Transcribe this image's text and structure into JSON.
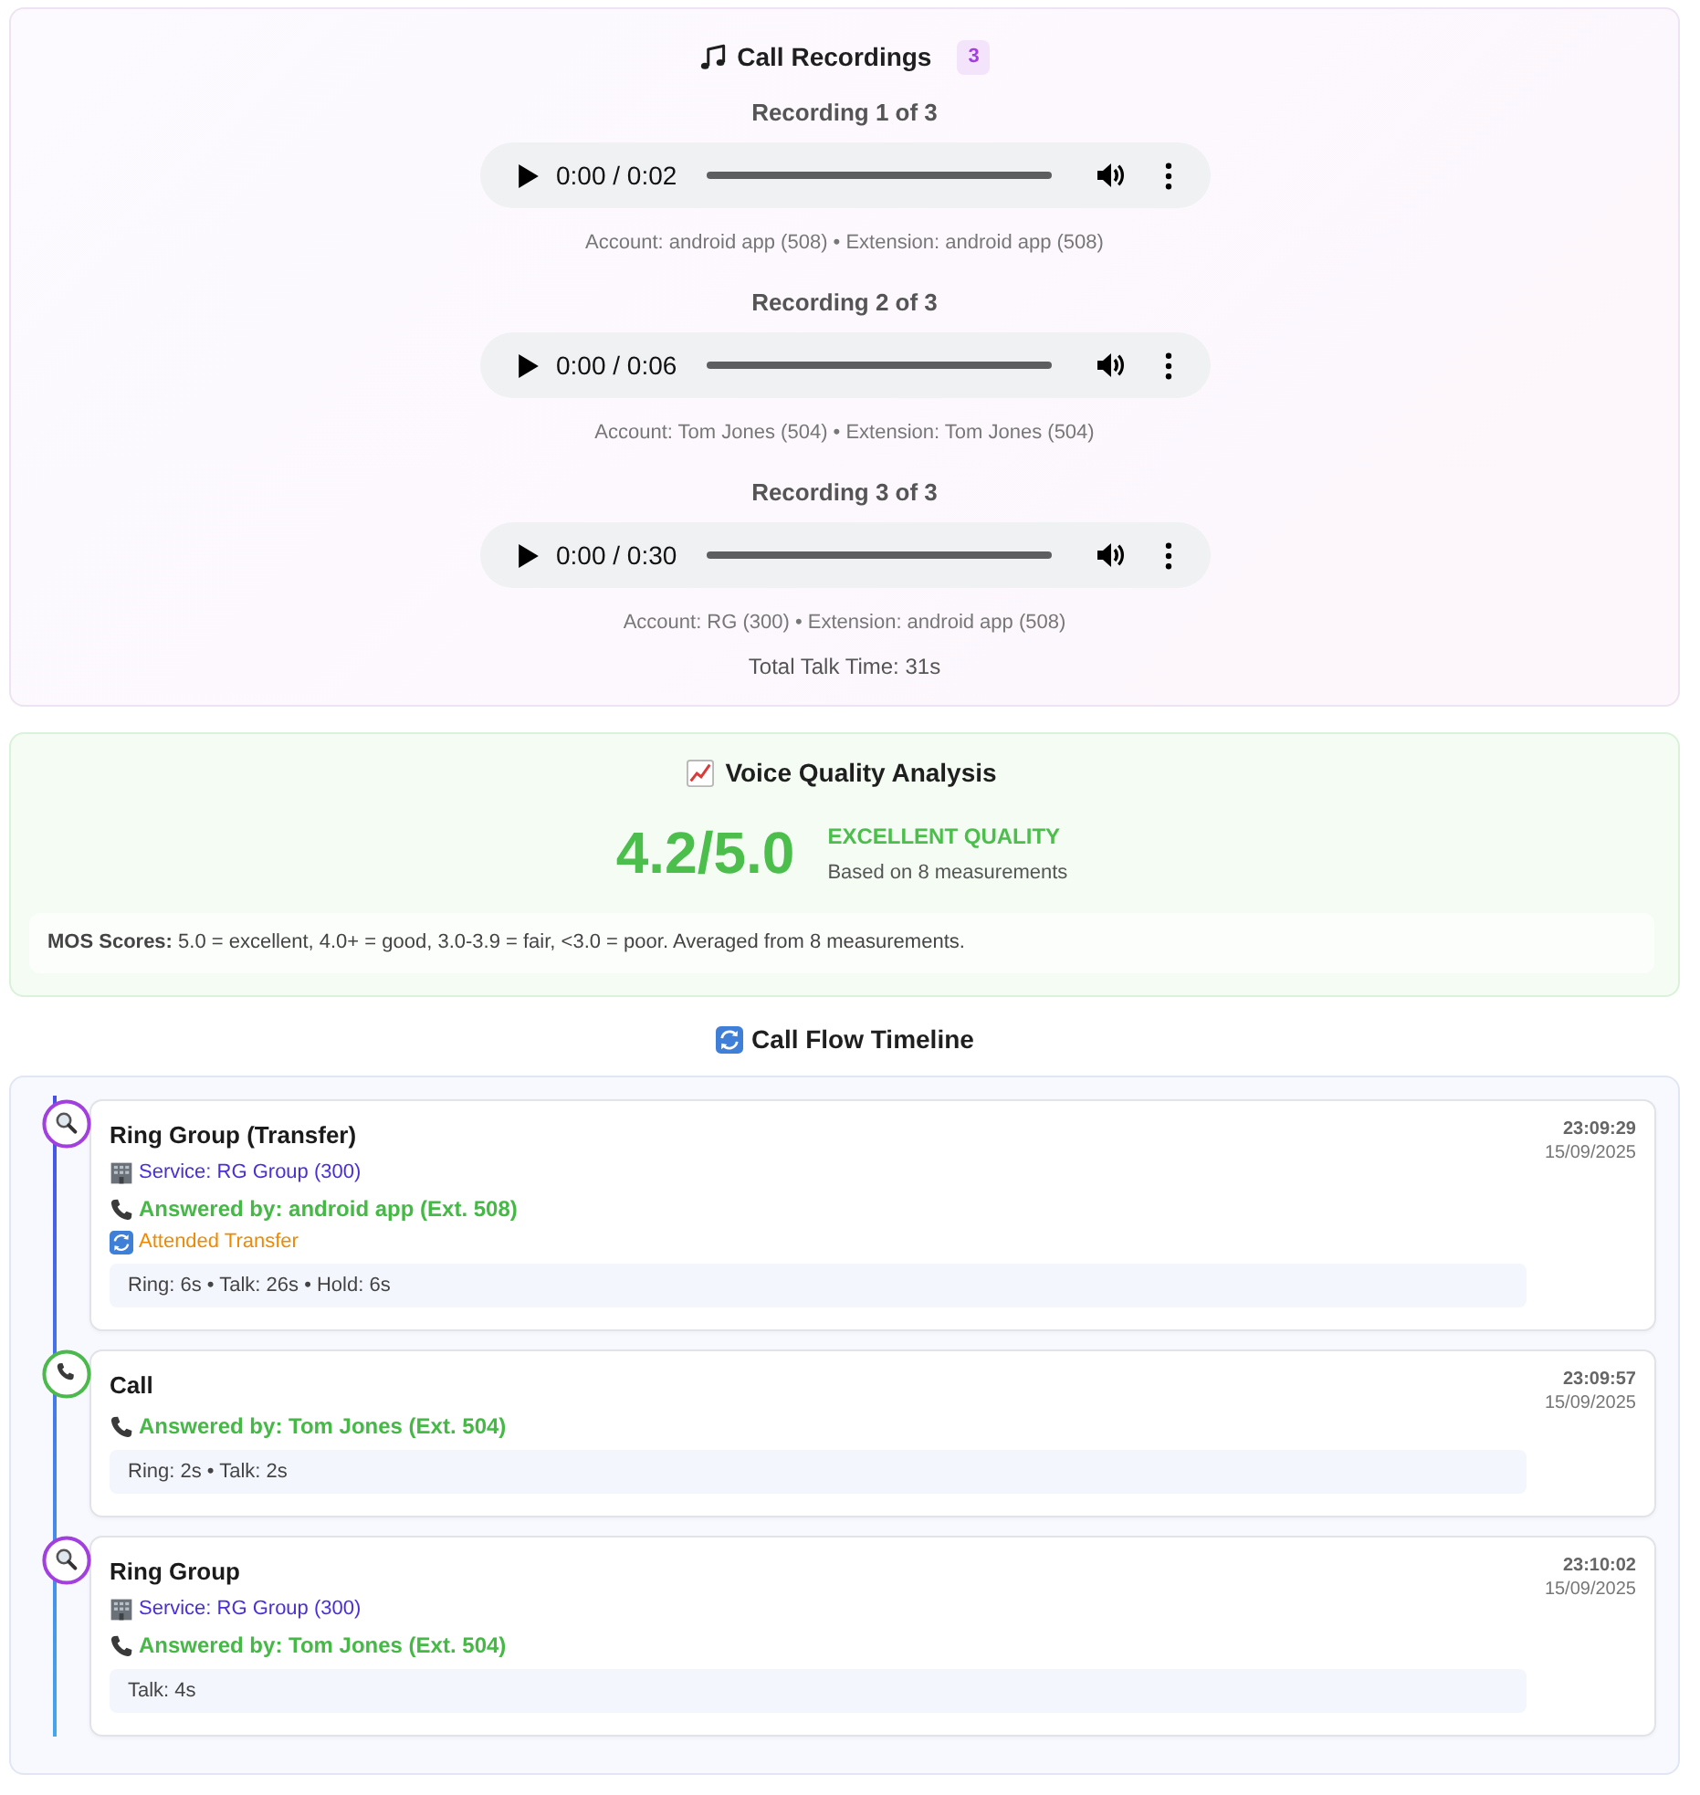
{
  "recordings": {
    "title": "Call Recordings",
    "count": "3",
    "items": [
      {
        "label": "Recording 1 of 3",
        "time": "0:00 / 0:02",
        "meta": "Account: android app (508) • Extension: android app (508)"
      },
      {
        "label": "Recording 2 of 3",
        "time": "0:00 / 0:06",
        "meta": "Account: Tom Jones (504) • Extension: Tom Jones (504)"
      },
      {
        "label": "Recording 3 of 3",
        "time": "0:00 / 0:30",
        "meta": "Account: RG (300) • Extension: android app (508)"
      }
    ],
    "total": "Total Talk Time: 31s"
  },
  "voice_quality": {
    "title": "Voice Quality Analysis",
    "score": "4.2/5.0",
    "rating": "EXCELLENT QUALITY",
    "basis": "Based on 8 measurements",
    "note": "**MOS Scores:** 5.0 = excellent, 4.0+ = good, 3.0-3.9 = fair, <3.0 = poor. Averaged from 8 measurements."
  },
  "timeline": {
    "title": "Call Flow Timeline",
    "events": [
      {
        "kind": "ring_group",
        "title": "Ring Group (Transfer)",
        "time": "23:09:29",
        "date": "15/09/2025",
        "service": "Service: RG Group (300)",
        "answered": "Answered by: android app (Ext. 508)",
        "transfer": "Attended Transfer",
        "stats": "Ring: 6s • Talk: 26s • Hold: 6s"
      },
      {
        "kind": "call",
        "title": "Call",
        "time": "23:09:57",
        "date": "15/09/2025",
        "answered": "Answered by: Tom Jones (Ext. 504)",
        "stats": "Ring: 2s • Talk: 2s"
      },
      {
        "kind": "ring_group",
        "title": "Ring Group",
        "time": "23:10:02",
        "date": "15/09/2025",
        "service": "Service: RG Group (300)",
        "answered": "Answered by: Tom Jones (Ext. 504)",
        "stats": "Talk: 4s"
      }
    ]
  }
}
